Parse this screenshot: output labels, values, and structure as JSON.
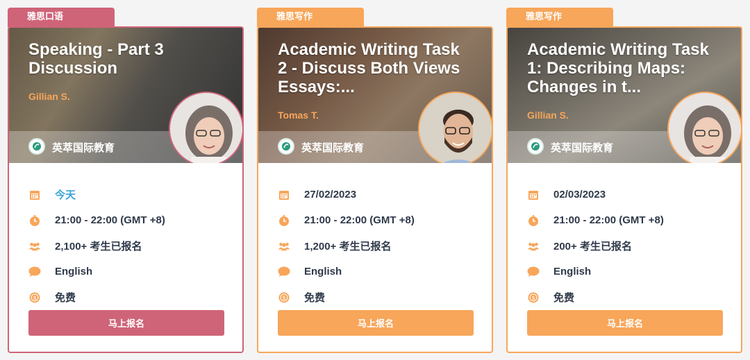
{
  "colors": {
    "pink": "#cf6478",
    "orange": "#f7a65a",
    "today_blue": "#3aa4d4",
    "text": "#2f3a4a"
  },
  "cards": [
    {
      "tag": "雅思口语",
      "title": "Speaking - Part 3 Discussion",
      "host": "Gillian S.",
      "brand": "英萃国际教育",
      "date": "今天",
      "time": "21:00 - 22:00 (GMT +8)",
      "registered": "2,100+ 考生已报名",
      "language": "English",
      "price": "免费",
      "button": "马上报名",
      "accent": "pink",
      "icons": [
        "calendar-icon",
        "clock-icon",
        "people-icon",
        "chat-bubble-icon",
        "coin-icon"
      ]
    },
    {
      "tag": "雅思写作",
      "title": "Academic Writing Task 2 - Discuss Both Views Essays:...",
      "host": "Tomas T.",
      "brand": "英萃国际教育",
      "date": "27/02/2023",
      "time": "21:00 - 22:00 (GMT +8)",
      "registered": "1,200+ 考生已报名",
      "language": "English",
      "price": "免费",
      "button": "马上报名",
      "accent": "orange",
      "icons": [
        "calendar-icon",
        "clock-icon",
        "people-icon",
        "chat-bubble-icon",
        "coin-icon"
      ]
    },
    {
      "tag": "雅思写作",
      "title": "Academic Writing Task 1: Describing Maps: Changes in t...",
      "host": "Gillian S.",
      "brand": "英萃国际教育",
      "date": "02/03/2023",
      "time": "21:00 - 22:00 (GMT +8)",
      "registered": "200+ 考生已报名",
      "language": "English",
      "price": "免费",
      "button": "马上报名",
      "accent": "orange",
      "icons": [
        "calendar-icon",
        "clock-icon",
        "people-icon",
        "chat-bubble-icon",
        "coin-icon"
      ]
    }
  ]
}
